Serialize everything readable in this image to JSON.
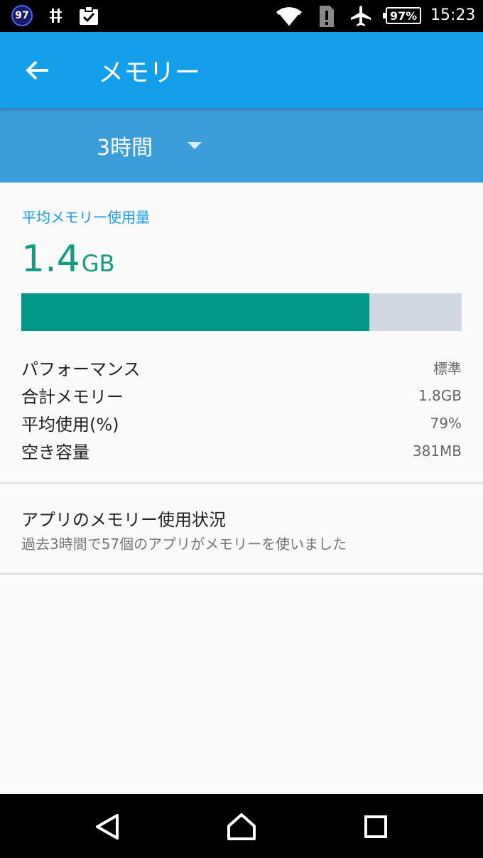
{
  "status_bar": {
    "notification_count": "97",
    "battery": "97%",
    "time": "15:23",
    "icons": [
      "notification-badge-icon",
      "usb-debug-icon",
      "clipboard-check-icon",
      "wifi-icon",
      "sim-alert-icon",
      "airplane-icon",
      "battery-icon"
    ]
  },
  "app_bar": {
    "title": "メモリー",
    "back_icon": "arrow-back-icon"
  },
  "range": {
    "selected": "3時間",
    "dropdown_icon": "triangle-down-icon"
  },
  "memory": {
    "section_label": "平均メモリー使用量",
    "average_value": "1.4",
    "average_unit": "GB",
    "usage_fraction": 0.79,
    "stats": [
      {
        "label": "パフォーマンス",
        "value": "標準"
      },
      {
        "label": "合計メモリー",
        "value": "1.8GB"
      },
      {
        "label": "平均使用(%)",
        "value": "79%"
      },
      {
        "label": "空き容量",
        "value": "381MB"
      }
    ]
  },
  "apps": {
    "title": "アプリのメモリー使用状況",
    "subtitle": "過去3時間で57個のアプリがメモリーを使いました"
  },
  "nav_bar": {
    "icons": [
      "back-triangle-icon",
      "home-icon",
      "recents-icon"
    ]
  },
  "colors": {
    "app_bar": "#159ee9",
    "range_bar": "#3b9ed9",
    "accent_label": "#1a9be6",
    "value_green": "#119c83",
    "bar_fill": "#009688",
    "bar_track": "#d1d8df"
  }
}
